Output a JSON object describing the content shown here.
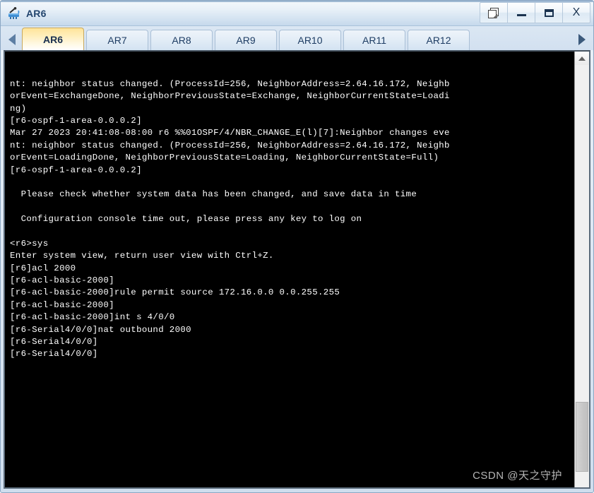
{
  "window": {
    "title": "AR6",
    "icon": "router-icon",
    "controls": {
      "restore_label": "",
      "minimize_label": "",
      "maximize_label": "",
      "close_label": "X"
    }
  },
  "tab_strip": {
    "scroll_left_icon": "triangle-left-icon",
    "scroll_right_icon": "triangle-right-icon",
    "active_tab": "AR6",
    "tabs": [
      {
        "label": "AR6",
        "active": true
      },
      {
        "label": "AR7",
        "active": false
      },
      {
        "label": "AR8",
        "active": false
      },
      {
        "label": "AR9",
        "active": false
      },
      {
        "label": "AR10",
        "active": false
      },
      {
        "label": "AR11",
        "active": false
      },
      {
        "label": "AR12",
        "active": false
      }
    ]
  },
  "terminal": {
    "background_color": "#000000",
    "text_color": "#ffffff",
    "lines": [
      "nt: neighbor status changed. (ProcessId=256, NeighborAddress=2.64.16.172, Neighb",
      "orEvent=ExchangeDone, NeighborPreviousState=Exchange, NeighborCurrentState=Loadi",
      "ng)",
      "[r6-ospf-1-area-0.0.0.2]",
      "Mar 27 2023 20:41:08-08:00 r6 %%01OSPF/4/NBR_CHANGE_E(l)[7]:Neighbor changes eve",
      "nt: neighbor status changed. (ProcessId=256, NeighborAddress=2.64.16.172, Neighb",
      "orEvent=LoadingDone, NeighborPreviousState=Loading, NeighborCurrentState=Full)",
      "[r6-ospf-1-area-0.0.0.2]",
      "",
      "  Please check whether system data has been changed, and save data in time",
      "",
      "  Configuration console time out, please press any key to log on",
      "",
      "<r6>sys",
      "Enter system view, return user view with Ctrl+Z.",
      "[r6]acl 2000",
      "[r6-acl-basic-2000]",
      "[r6-acl-basic-2000]rule permit source 172.16.0.0 0.0.255.255",
      "[r6-acl-basic-2000]",
      "[r6-acl-basic-2000]int s 4/0/0",
      "[r6-Serial4/0/0]nat outbound 2000",
      "[r6-Serial4/0/0]",
      "[r6-Serial4/0/0]"
    ]
  },
  "watermark": {
    "text": "CSDN @天之守护"
  },
  "scrollbar": {
    "up_icon": "chevron-up-icon",
    "orientation": "vertical"
  }
}
